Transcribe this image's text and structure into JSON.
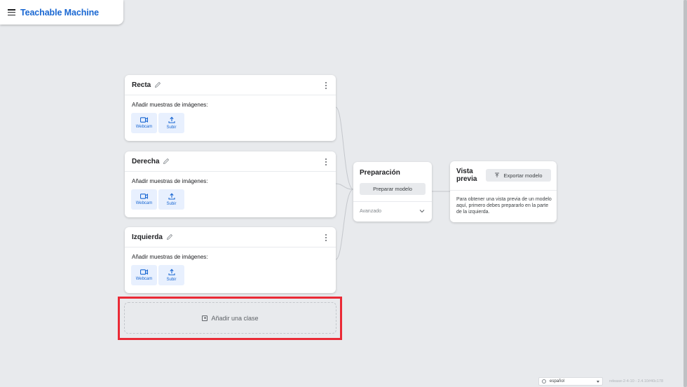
{
  "header": {
    "title": "Teachable Machine"
  },
  "classes": [
    {
      "name": "Recta",
      "samples_label": "Añadir muestras de imágenes:",
      "webcam_label": "Webcam",
      "upload_label": "Subir"
    },
    {
      "name": "Derecha",
      "samples_label": "Añadir muestras de imágenes:",
      "webcam_label": "Webcam",
      "upload_label": "Subir"
    },
    {
      "name": "Izquierda",
      "samples_label": "Añadir muestras de imágenes:",
      "webcam_label": "Webcam",
      "upload_label": "Subir"
    }
  ],
  "add_class": {
    "label": "Añadir una clase"
  },
  "training": {
    "title": "Preparación",
    "button": "Preparar modelo",
    "advanced": "Avanzado"
  },
  "preview": {
    "title": "Vista previa",
    "export_button": "Exportar modelo",
    "description": "Para obtener una vista previa de un modelo aquí, primero debes prepararlo en la parte de la izquierda."
  },
  "footer": {
    "language": "español",
    "version": "release-2-4-10 - 2.4.10#40c178"
  },
  "colors": {
    "accent": "#1967d2",
    "highlight": "#ea2a36",
    "background": "#e8eaed"
  }
}
